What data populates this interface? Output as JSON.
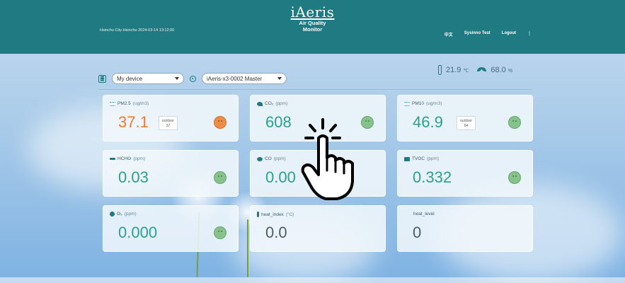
{
  "header": {
    "location_time": "Hsinchu City-Hsinchu 2024-03-14 13:12:00",
    "brand": "iAeris",
    "subtitle_line1": "Air Quality",
    "subtitle_line2": "Monitor",
    "lang": "中文",
    "user": "Sysinno Test",
    "logout": "Logout",
    "menu": "⋮"
  },
  "toolbar": {
    "device_select": "My device",
    "station_select": "iAeris-x3-0002 Master"
  },
  "weather": {
    "temperature": "21.9",
    "temp_unit": "℃",
    "humidity": "68.0",
    "humidity_unit": "%"
  },
  "cards": [
    {
      "label": "PM2.5",
      "unit": "(ug/m3)",
      "value": "37.1",
      "outdoor_label": "outdoor",
      "outdoor_value": "37",
      "status": "warn"
    },
    {
      "label": "CO₂",
      "unit": "(ppm)",
      "value": "608",
      "status": "good"
    },
    {
      "label": "PM10",
      "unit": "(ug/m3)",
      "value": "46.9",
      "outdoor_label": "outdoor",
      "outdoor_value": "64",
      "status": "good"
    },
    {
      "label": "HCHO",
      "unit": "(ppm)",
      "value": "0.03",
      "status": "good"
    },
    {
      "label": "CO",
      "unit": "(ppm)",
      "value": "0.00",
      "status": "good"
    },
    {
      "label": "TVOC",
      "unit": "(ppm)",
      "value": "0.332",
      "status": "good"
    },
    {
      "label": "O₃",
      "unit": "(ppm)",
      "value": "0.000",
      "status": "good"
    },
    {
      "label": "heat_index",
      "unit": "(°C)",
      "value": "0.0"
    },
    {
      "label": "heat_level",
      "unit": "",
      "value": "0"
    }
  ],
  "colors": {
    "header": "#1f7a82",
    "good": "#2ba08b",
    "warn": "#f07b30"
  },
  "icons": [
    "thermometer-icon",
    "leaf-icon",
    "location-pin-icon",
    "device-list-icon",
    "pointer-hand-icon"
  ]
}
